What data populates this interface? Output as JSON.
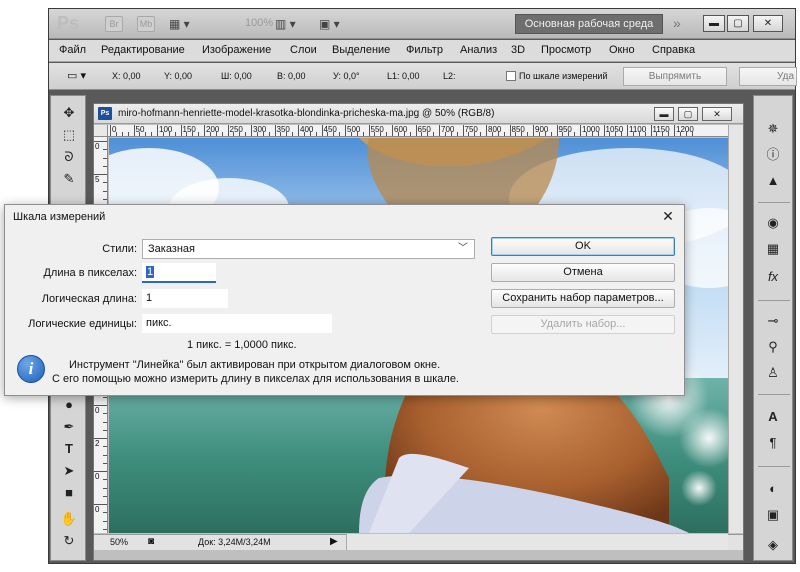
{
  "app": {
    "logo": "Ps",
    "chip_br": "Br",
    "chip_mb": "Mb",
    "zoom": "100%",
    "workspace": "Основная рабочая среда",
    "chevrons": "»"
  },
  "menu": [
    "Файл",
    "Редактирование",
    "Изображение",
    "Слои",
    "Выделение",
    "Фильтр",
    "Анализ",
    "3D",
    "Просмотр",
    "Окно",
    "Справка"
  ],
  "options": {
    "x": "X: 0,00",
    "y": "Y: 0,00",
    "w": "Ш: 0,00",
    "h": "В: 0,00",
    "angle": "У: 0,0°",
    "l1": "L1: 0,00",
    "l2": "L2:",
    "use_scale": "По шкале измерений",
    "straighten": "Выпрямить",
    "delete": "Уда"
  },
  "document": {
    "title": "miro-hofmann-henriette-model-krasotka-blondinka-pricheska-ma.jpg @ 50% (RGB/8)",
    "ruler_top": [
      "0",
      "50",
      "100",
      "150",
      "200",
      "250",
      "300",
      "350",
      "400",
      "450",
      "500",
      "550",
      "600",
      "650",
      "700",
      "750",
      "800",
      "850",
      "900",
      "950",
      "1000",
      "1050",
      "1100",
      "1150",
      "1200"
    ],
    "ruler_left": [
      "0",
      "5",
      "0",
      "1",
      "0",
      "0",
      "1",
      "5",
      "0",
      "2",
      "0",
      "0"
    ],
    "zoom": "50%",
    "doc_info": "Док: 3,24M/3,24M"
  },
  "dialog": {
    "title": "Шкала измерений",
    "close": "✕",
    "styles_label": "Стили:",
    "styles_value": "Заказная",
    "pixel_length_label": "Длина в пикселах:",
    "pixel_length_value": "1",
    "logical_length_label": "Логическая длина:",
    "logical_length_value": "1",
    "logical_units_label": "Логические единицы:",
    "logical_units_value": "пикс.",
    "scale_summary": "1 пикс. = 1,0000 пикс.",
    "ok": "OK",
    "cancel": "Отмена",
    "save_preset": "Сохранить набор параметров...",
    "delete_preset": "Удалить набор...",
    "info_line1": "Инструмент \"Линейка\" был активирован при открытом диалоговом окне.",
    "info_line2": "С его помощью можно измерить длину в пикселах для использования в шкале."
  },
  "colors": {
    "accent": "#2b68c9",
    "workspace_bg": "#6e6e6e",
    "sky": "#9cc4ea",
    "sea": "#3f8f7e",
    "skin": "#a8602f",
    "shirt": "#cdd3e8"
  },
  "icons": [
    "move-icon",
    "marquee-icon",
    "lasso-icon",
    "quick-select-icon",
    "zoom-icon",
    "pen-icon",
    "type-icon",
    "path-select-icon",
    "shape-icon",
    "hand-icon",
    "rotate-view-icon",
    "navigator-icon",
    "info-icon",
    "histogram-icon",
    "color-icon",
    "swatches-icon",
    "styles-icon",
    "adjustments-icon",
    "masks-icon",
    "clone-source-icon",
    "character-icon",
    "paragraph-icon",
    "mask-icon",
    "layers-icon"
  ]
}
